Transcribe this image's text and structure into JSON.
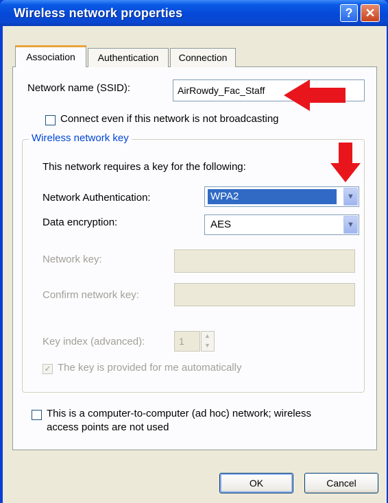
{
  "window": {
    "title": "Wireless network properties",
    "help_glyph": "?",
    "close_glyph": "✕"
  },
  "tabs": [
    {
      "label": "Association",
      "selected": true
    },
    {
      "label": "Authentication",
      "selected": false
    },
    {
      "label": "Connection",
      "selected": false
    }
  ],
  "ssid": {
    "label": "Network name (SSID):",
    "value": "AirRowdy_Fac_Staff"
  },
  "broadcast_checkbox": {
    "label": "Connect even if this network is not broadcasting",
    "checked": false
  },
  "key_group": {
    "legend": "Wireless network key",
    "intro": "This network requires a key for the following:",
    "auth_label": "Network Authentication:",
    "auth_value": "WPA2",
    "enc_label": "Data encryption:",
    "enc_value": "AES",
    "netkey_label": "Network key:",
    "confirm_label": "Confirm network key:",
    "keyindex_label": "Key index (advanced):",
    "keyindex_value": "1",
    "auto_key_label": "The key is provided for me automatically",
    "auto_key_checked": true
  },
  "adhoc": {
    "line1": "This is a computer-to-computer (ad hoc) network; wireless",
    "line2": "access points are not used",
    "checked": false
  },
  "buttons": {
    "ok": "OK",
    "cancel": "Cancel"
  },
  "colors": {
    "title_bar": "#0548d8",
    "dialog_bg": "#ece9d8",
    "selection": "#316ac5",
    "annotation_arrow": "#e8161c"
  },
  "icons": {
    "arrow": "red-arrow-icon",
    "dropdown": "chevron-down-icon"
  }
}
